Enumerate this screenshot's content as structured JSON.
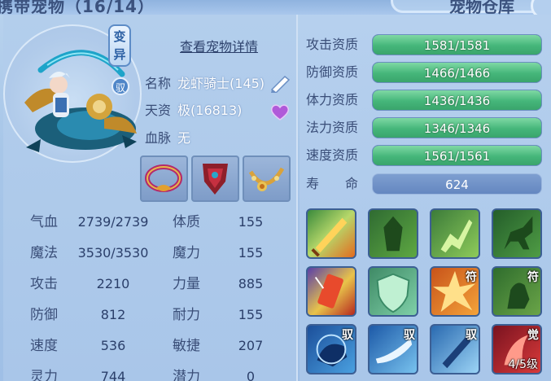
{
  "header": {
    "title_left": "携带宠物（16/14）",
    "title_right": "宠物仓库"
  },
  "pet": {
    "mutant_badge": "变异",
    "ride_badge": "驭",
    "detail_link": "查看宠物详情",
    "name_label": "名称",
    "name_value": "龙虾骑士(145)",
    "aptitude_label": "天资",
    "aptitude_value": "极(16813)",
    "bloodline_label": "血脉",
    "bloodline_value": "无"
  },
  "stats": {
    "hp_label": "气血",
    "hp_value": "2739/2739",
    "mp_label": "魔法",
    "mp_value": "3530/3530",
    "atk_label": "攻击",
    "atk_value": "2210",
    "def_label": "防御",
    "def_value": "812",
    "spd_label": "速度",
    "spd_value": "536",
    "spirit_label": "灵力",
    "spirit_value": "744",
    "con_label": "体质",
    "con_value": "155",
    "mag_label": "魔力",
    "mag_value": "155",
    "str_label": "力量",
    "str_value": "885",
    "end_label": "耐力",
    "end_value": "155",
    "agi_label": "敏捷",
    "agi_value": "207",
    "pot_label": "潜力",
    "pot_value": "0"
  },
  "aptitudes": [
    {
      "label": "攻击资质",
      "value": "1581/1581",
      "fill": 1.0
    },
    {
      "label": "防御资质",
      "value": "1466/1466",
      "fill": 1.0
    },
    {
      "label": "体力资质",
      "value": "1436/1436",
      "fill": 1.0
    },
    {
      "label": "法力资质",
      "value": "1346/1346",
      "fill": 1.0
    },
    {
      "label": "速度资质",
      "value": "1561/1561",
      "fill": 1.0
    }
  ],
  "life": {
    "label": "寿　　命",
    "value": "624"
  },
  "skills": [
    {
      "icon": "flame-sword-icon",
      "tag": "",
      "level": ""
    },
    {
      "icon": "green-beast-icon",
      "tag": "",
      "level": ""
    },
    {
      "icon": "green-warrior-icon",
      "tag": "",
      "level": ""
    },
    {
      "icon": "green-horse-icon",
      "tag": "",
      "level": ""
    },
    {
      "icon": "lightning-scroll-icon",
      "tag": "",
      "level": ""
    },
    {
      "icon": "green-shield-icon",
      "tag": "",
      "level": ""
    },
    {
      "icon": "orange-burst-icon",
      "tag": "符",
      "level": ""
    },
    {
      "icon": "green-giant-icon",
      "tag": "符",
      "level": ""
    },
    {
      "icon": "blue-beast-icon",
      "tag": "驭",
      "level": ""
    },
    {
      "icon": "blue-dash-icon",
      "tag": "驭",
      "level": ""
    },
    {
      "icon": "blue-blade-icon",
      "tag": "驭",
      "level": ""
    },
    {
      "icon": "red-awaken-icon",
      "tag": "觉",
      "level": "4/5级"
    }
  ],
  "colors": {
    "bar_green": "#45b67a",
    "bar_track": "#3d5f96",
    "panel_blue": "#a9c6e9"
  }
}
